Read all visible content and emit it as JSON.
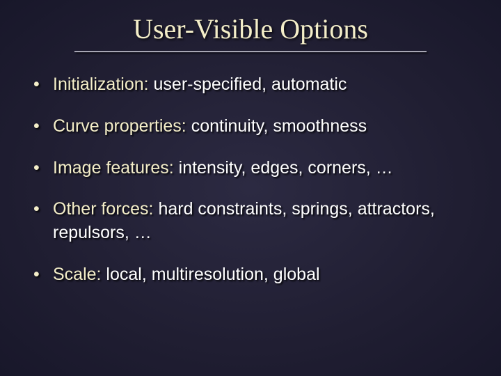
{
  "title": "User-Visible Options",
  "items": [
    {
      "label": "Initialization:",
      "detail": " user-specified, automatic"
    },
    {
      "label": "Curve properties:",
      "detail": " continuity, smoothness"
    },
    {
      "label": "Image features:",
      "detail": " intensity, edges, corners, …"
    },
    {
      "label": "Other forces:",
      "detail": " hard constraints, springs, attractors, repulsors, …"
    },
    {
      "label": "Scale:",
      "detail": " local, multiresolution, global"
    }
  ]
}
